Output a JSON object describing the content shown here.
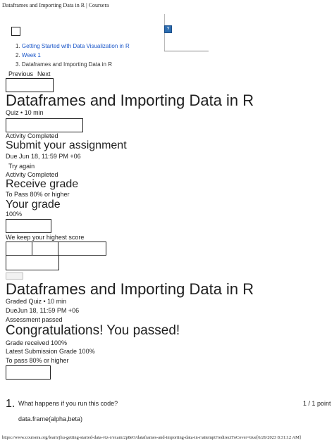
{
  "browser": {
    "tab_title": "Dataframes and Importing Data in R | Coursera",
    "footer_url": "https://www.coursera.org/learn/jhu-getting-started-data-viz-r/exam/2p8eO/dataframes-and-importing-data-in-r/attempt?redirectToCover=true[6/26/2023 8:31:12 AM]"
  },
  "breadcrumb": {
    "items": [
      {
        "num": "1.",
        "label": "Getting Started with Data Visualization in R"
      },
      {
        "num": "2.",
        "label": "Week 1"
      },
      {
        "num": "3.",
        "label": "Dataframes and Importing Data in R"
      }
    ]
  },
  "nav": {
    "previous": "Previous",
    "next": "Next"
  },
  "quiz": {
    "title": "Dataframes and Importing Data in R",
    "meta": "Quiz • 10 min",
    "status": "Activity Completed"
  },
  "submit": {
    "heading": "Submit your assignment",
    "due": "Due Jun 18, 11:59 PM +06",
    "try_again": "Try again",
    "status": "Activity Completed"
  },
  "receive": {
    "heading": "Receive grade",
    "to_pass": "To Pass 80% or higher"
  },
  "grade": {
    "heading": "Your grade",
    "value": "100%",
    "note": "We keep your highest score"
  },
  "graded": {
    "title": "Dataframes and Importing Data in R",
    "meta": "Graded Quiz • 10 min",
    "due": "DueJun 18, 11:59 PM +06",
    "assessment": "Assessment passed",
    "congrats": "Congratulations! You passed!",
    "received": "Grade received 100%",
    "latest": "Latest Submission Grade 100%",
    "to_pass": "To pass 80% or higher"
  },
  "question": {
    "number": "1.",
    "text": "What happens if you run this code?",
    "points": "1 / 1 point",
    "code": "data.frame(alpha,beta)"
  },
  "icons": {
    "help": "?"
  },
  "colors": {
    "link": "#1a56c9",
    "help_icon": "#2b6cb0"
  }
}
